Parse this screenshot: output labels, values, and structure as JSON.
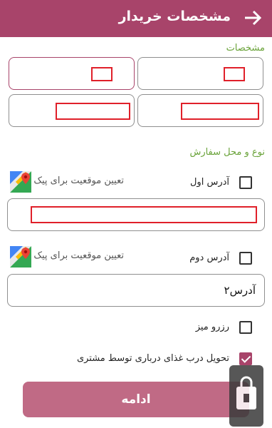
{
  "header": {
    "title": "مشخصات خریدار",
    "back_icon": "arrow-right-icon",
    "background": "#a8446a"
  },
  "buyer": {
    "section_label": "مشخصات"
  },
  "order": {
    "section_label": "نوع و محل سفارش",
    "address1": {
      "label": "آدرس اول",
      "checked": false,
      "locate_text": "تعیین موقعیت برای پیک"
    },
    "address2": {
      "label": "آدرس دوم",
      "checked": false,
      "locate_text": "تعیین موقعیت برای پیک",
      "value": "آدرس۲"
    },
    "reserve_table": {
      "label": "رزرو میز",
      "checked": false
    },
    "door_delivery": {
      "label": "تحویل درب غذای درباری توسط مشتری",
      "checked": true
    }
  },
  "actions": {
    "continue_label": "ادامه"
  },
  "colors": {
    "accent": "#a8446a",
    "section_green": "#6aa33a",
    "button": "#c06a85",
    "redaction": "#e0202a"
  }
}
